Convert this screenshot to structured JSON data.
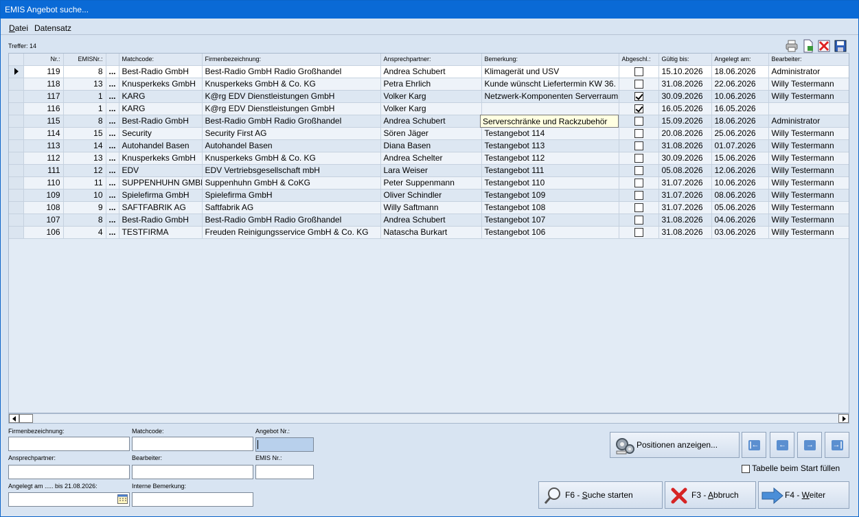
{
  "window": {
    "title": "EMIS Angebot suche..."
  },
  "menu": [
    {
      "label": "Datei",
      "accel": "D"
    },
    {
      "label": "Datensatz",
      "accel": ""
    }
  ],
  "hits": "Treffer: 14",
  "toolbar_icons": [
    "printer-icon",
    "export-icon",
    "delete-icon",
    "save-icon"
  ],
  "columns": [
    "",
    "Nr.:",
    "EMISNr.:",
    "",
    "Matchcode:",
    "Firmenbezeichnung:",
    "Ansprechpartner:",
    "Bemerkung:",
    "Abgeschl.:",
    "Gültig bis:",
    "Angelegt am:",
    "Bearbeiter:"
  ],
  "rows": [
    {
      "nr": "119",
      "emis": "8",
      "match": "Best-Radio GmbH",
      "firma": "Best-Radio GmbH Radio Großhandel",
      "ansprech": "Andrea Schubert",
      "bem": "Klimagerät und USV",
      "abg": false,
      "gueltig": "15.10.2026",
      "angelegt": "18.06.2026",
      "bearb": "Administrator",
      "selected": true
    },
    {
      "nr": "118",
      "emis": "13",
      "match": "Knusperkeks GmbH",
      "firma": "Knusperkeks GmbH & Co. KG",
      "ansprech": "Petra Ehrlich",
      "bem": "Kunde wünscht Liefertermin KW 36.",
      "abg": false,
      "gueltig": "31.08.2026",
      "angelegt": "22.06.2026",
      "bearb": "Willy Testermann"
    },
    {
      "nr": "117",
      "emis": "1",
      "match": "KARG",
      "firma": "K@rg EDV Dienstleistungen GmbH",
      "ansprech": "Volker Karg",
      "bem": "Netzwerk-Komponenten Serverraum",
      "abg": true,
      "gueltig": "30.09.2026",
      "angelegt": "10.06.2026",
      "bearb": "Willy Testermann"
    },
    {
      "nr": "116",
      "emis": "1",
      "match": "KARG",
      "firma": "K@rg EDV Dienstleistungen GmbH",
      "ansprech": "Volker Karg",
      "bem": "",
      "abg": true,
      "gueltig": "16.05.2026",
      "angelegt": "16.05.2026",
      "bearb": ""
    },
    {
      "nr": "115",
      "emis": "8",
      "match": "Best-Radio GmbH",
      "firma": "Best-Radio GmbH Radio Großhandel",
      "ansprech": "Andrea Schubert",
      "bem": "",
      "abg": false,
      "gueltig": "15.09.2026",
      "angelegt": "18.06.2026",
      "bearb": "Administrator"
    },
    {
      "nr": "114",
      "emis": "15",
      "match": "Security",
      "firma": "Security First AG",
      "ansprech": "Sören Jäger",
      "bem": "Testangebot 114",
      "abg": false,
      "gueltig": "20.08.2026",
      "angelegt": "25.06.2026",
      "bearb": "Willy Testermann"
    },
    {
      "nr": "113",
      "emis": "14",
      "match": "Autohandel Basen",
      "firma": "Autohandel Basen",
      "ansprech": "Diana Basen",
      "bem": "Testangebot 113",
      "abg": false,
      "gueltig": "31.08.2026",
      "angelegt": "01.07.2026",
      "bearb": "Willy Testermann"
    },
    {
      "nr": "112",
      "emis": "13",
      "match": "Knusperkeks GmbH",
      "firma": "Knusperkeks GmbH & Co. KG",
      "ansprech": "Andrea Schelter",
      "bem": "Testangebot 112",
      "abg": false,
      "gueltig": "30.09.2026",
      "angelegt": "15.06.2026",
      "bearb": "Willy Testermann"
    },
    {
      "nr": "111",
      "emis": "12",
      "match": "EDV",
      "firma": "EDV Vertriebsgesellschaft mbH",
      "ansprech": "Lara Weiser",
      "bem": "Testangebot 111",
      "abg": false,
      "gueltig": "05.08.2026",
      "angelegt": "12.06.2026",
      "bearb": "Willy Testermann"
    },
    {
      "nr": "110",
      "emis": "11",
      "match": "SUPPENHUHN GMBH",
      "firma": "Suppenhuhn GmbH & CoKG",
      "ansprech": "Peter Suppenmann",
      "bem": "Testangebot 110",
      "abg": false,
      "gueltig": "31.07.2026",
      "angelegt": "10.06.2026",
      "bearb": "Willy Testermann"
    },
    {
      "nr": "109",
      "emis": "10",
      "match": "Spielefirma GmbH",
      "firma": "Spielefirma GmbH",
      "ansprech": "Oliver Schindler",
      "bem": "Testangebot 109",
      "abg": false,
      "gueltig": "31.07.2026",
      "angelegt": "08.06.2026",
      "bearb": "Willy Testermann"
    },
    {
      "nr": "108",
      "emis": "9",
      "match": "SAFTFABRIK AG",
      "firma": "Saftfabrik AG",
      "ansprech": "Willy Saftmann",
      "bem": "Testangebot 108",
      "abg": false,
      "gueltig": "31.07.2026",
      "angelegt": "05.06.2026",
      "bearb": "Willy Testermann"
    },
    {
      "nr": "107",
      "emis": "8",
      "match": "Best-Radio GmbH",
      "firma": "Best-Radio GmbH Radio Großhandel",
      "ansprech": "Andrea Schubert",
      "bem": "Testangebot 107",
      "abg": false,
      "gueltig": "31.08.2026",
      "angelegt": "04.06.2026",
      "bearb": "Willy Testermann"
    },
    {
      "nr": "106",
      "emis": "4",
      "match": "TESTFIRMA",
      "firma": "Freuden Reinigungsservice GmbH & Co. KG",
      "ansprech": "Natascha Burkart",
      "bem": "Testangebot 106",
      "abg": false,
      "gueltig": "31.08.2026",
      "angelegt": "03.06.2026",
      "bearb": "Willy Testermann"
    }
  ],
  "dots": "...",
  "tooltip": "Serverschränke und Rackzubehör",
  "filters": {
    "firma_label": "Firmenbezeichnung:",
    "match_label": "Matchcode:",
    "angebot_label": "Angebot Nr.:",
    "ansprech_label": "Ansprechpartner:",
    "bearb_label": "Bearbeiter:",
    "emis_label": "EMIS Nr.:",
    "angelegt_label": "Angelegt am ..... bis 21.08.2026:",
    "intern_label": "Interne Bemerkung:"
  },
  "buttons": {
    "positionen": "Positionen anzeigen...",
    "suche_pre": "F6 - ",
    "suche_accel": "S",
    "suche_post": "uche starten",
    "abbruch_pre": "F3 - ",
    "abbruch_accel": "A",
    "abbruch_post": "bbruch",
    "weiter_pre": "F4 - ",
    "weiter_accel": "W",
    "weiter_post": "eiter"
  },
  "fill_on_start": {
    "label": "Tabelle beim Start füllen",
    "checked": false
  }
}
